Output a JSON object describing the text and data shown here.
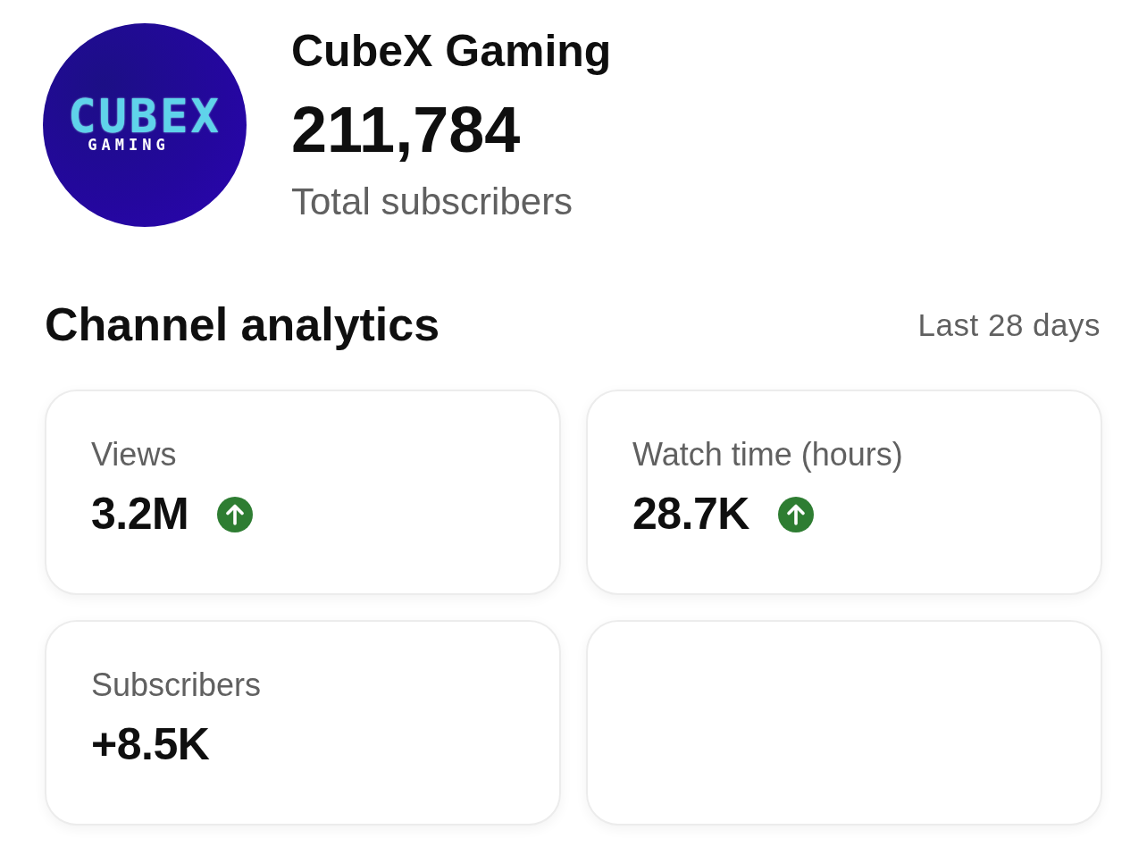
{
  "channel": {
    "logo": {
      "wordmark": "CUBEX",
      "tagline": "GAMING"
    },
    "name": "CubeX Gaming",
    "subscriber_count": "211,784",
    "subscriber_label": "Total subscribers"
  },
  "analytics": {
    "title": "Channel analytics",
    "period": "Last 28 days",
    "cards": [
      {
        "kind": "metric",
        "label": "Views",
        "value": "3.2M",
        "trending_up": true
      },
      {
        "kind": "metric",
        "label": "Watch time (hours)",
        "value": "28.7K",
        "trending_up": true
      },
      {
        "kind": "metric",
        "label": "Subscribers",
        "value": "+8.5K",
        "trending_up": false
      },
      {
        "kind": "empty"
      }
    ]
  }
}
